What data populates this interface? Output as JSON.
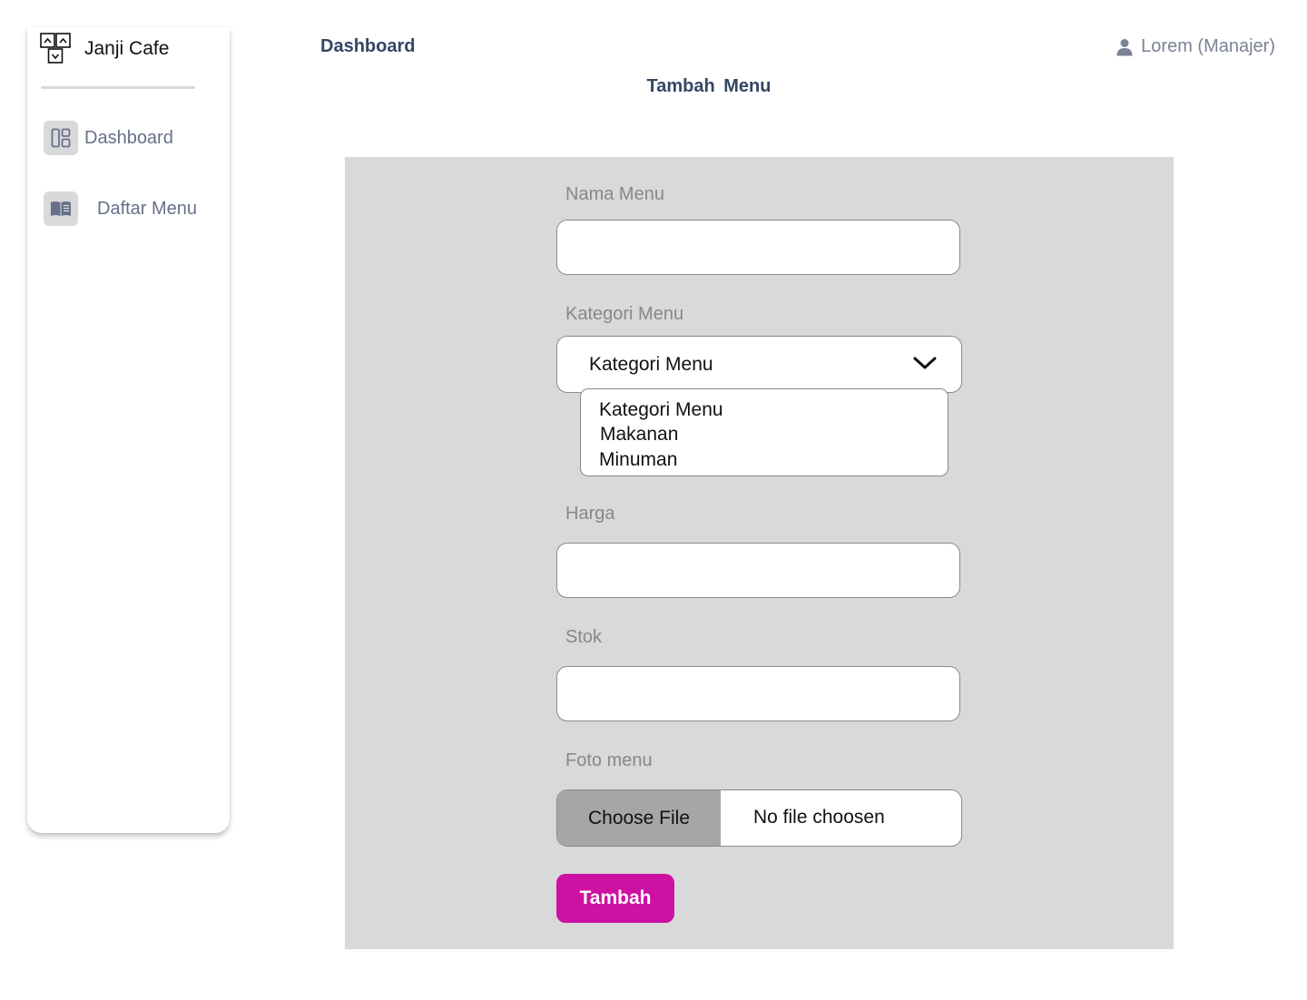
{
  "sidebar": {
    "brand_name": "Janji Cafe",
    "brand_icon": "cafe-logo-icon",
    "items": [
      {
        "label": "Dashboard",
        "icon": "dashboard-layout-icon"
      },
      {
        "label": "Daftar Menu",
        "icon": "book-menu-icon"
      }
    ]
  },
  "header": {
    "title": "Dashboard",
    "user_label": "Lorem (Manajer)",
    "user_icon": "user-icon"
  },
  "page": {
    "heading": "Tambah Menu"
  },
  "form": {
    "nama_menu": {
      "label": "Nama Menu",
      "value": ""
    },
    "kategori": {
      "label": "Kategori Menu",
      "selected": "Kategori Menu",
      "options": [
        "Kategori Menu",
        "Makanan",
        "Minuman"
      ]
    },
    "harga": {
      "label": "Harga",
      "value": ""
    },
    "stok": {
      "label": "Stok",
      "value": ""
    },
    "foto": {
      "label": "Foto menu",
      "button_label": "Choose File",
      "status": "No file choosen"
    },
    "submit_label": "Tambah"
  },
  "colors": {
    "accent": "#cc11a3",
    "panel_bg": "#d9d9d9",
    "nav_text": "#66708a",
    "header_text": "#344563"
  }
}
